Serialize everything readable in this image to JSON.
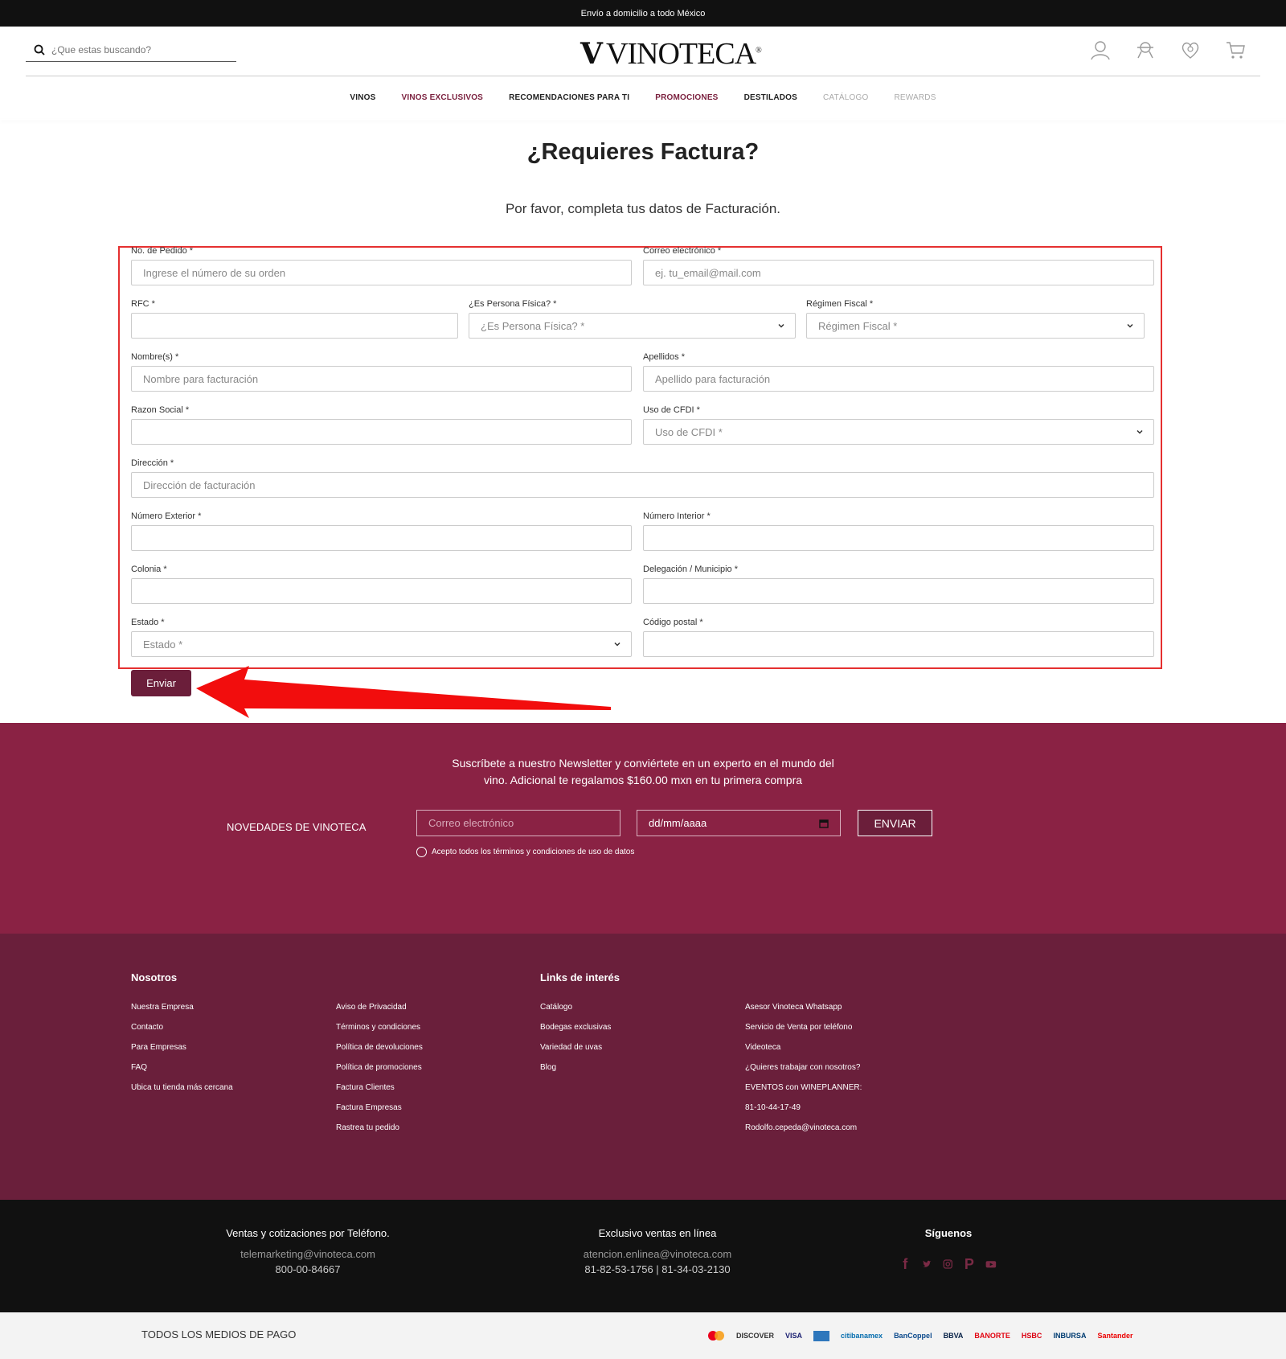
{
  "topbar": {
    "text": "Envío a domicilio a todo México"
  },
  "header": {
    "search_placeholder": "¿Que estas buscando?",
    "logo_text": "VINOTECA",
    "logo_reg": "®"
  },
  "nav": {
    "items": [
      {
        "label": "VINOS",
        "style": "dark"
      },
      {
        "label": "VINOS EXCLUSIVOS",
        "style": "red"
      },
      {
        "label": "RECOMENDACIONES PARA TI",
        "style": "dark"
      },
      {
        "label": "PROMOCIONES",
        "style": "red"
      },
      {
        "label": "DESTILADOS",
        "style": "dark"
      },
      {
        "label": "CATÁLOGO",
        "style": "gray"
      },
      {
        "label": "REWARDS",
        "style": "gray"
      }
    ]
  },
  "page": {
    "title": "¿Requieres Factura?",
    "subtitle": "Por favor, completa tus datos de Facturación."
  },
  "form": {
    "pedido": {
      "label": "No. de Pedido *",
      "placeholder": "Ingrese el número de su orden"
    },
    "correo": {
      "label": "Correo electrónico *",
      "placeholder": "ej. tu_email@mail.com"
    },
    "rfc": {
      "label": "RFC *",
      "placeholder": ""
    },
    "persona": {
      "label": "¿Es Persona Física? *",
      "placeholder": "¿Es Persona Física? *"
    },
    "regimen": {
      "label": "Régimen Fiscal *",
      "placeholder": "Régimen Fiscal *"
    },
    "nombre": {
      "label": "Nombre(s) *",
      "placeholder": "Nombre para facturación"
    },
    "apellidos": {
      "label": "Apellidos *",
      "placeholder": "Apellido para facturación"
    },
    "razon": {
      "label": "Razon Social *",
      "placeholder": ""
    },
    "cfdi": {
      "label": "Uso de CFDI *",
      "placeholder": "Uso de CFDI *"
    },
    "direccion": {
      "label": "Dirección *",
      "placeholder": "Dirección de facturación"
    },
    "num_ext": {
      "label": "Número Exterior *",
      "placeholder": ""
    },
    "num_int": {
      "label": "Número Interior *",
      "placeholder": ""
    },
    "colonia": {
      "label": "Colonia *",
      "placeholder": ""
    },
    "delegacion": {
      "label": "Delegación / Municipio *",
      "placeholder": ""
    },
    "estado": {
      "label": "Estado *",
      "placeholder": "Estado *"
    },
    "cp": {
      "label": "Código postal *",
      "placeholder": ""
    },
    "submit": "Enviar"
  },
  "newsletter": {
    "text": "Suscríbete a nuestro Newsletter y conviértete en un experto en el mundo del vino. Adicional te regalamos $160.00 mxn en tu primera compra",
    "label": "NOVEDADES DE VINOTECA",
    "email_placeholder": "Correo electrónico",
    "date_placeholder": "dd/mm/aaaa",
    "send": "ENVIAR",
    "terms": "Acepto todos los términos y condiciones de uso de datos"
  },
  "footer": {
    "nosotros_title": "Nosotros",
    "links_title": "Links de interés",
    "col1": [
      "Nuestra Empresa",
      "Contacto",
      "Para Empresas",
      "FAQ",
      "Ubica tu tienda más cercana"
    ],
    "col2": [
      "Aviso de Privacidad",
      "Términos y condiciones",
      "Política de devoluciones",
      "Política de promociones",
      "Factura Clientes",
      "Factura Empresas",
      "Rastrea tu pedido"
    ],
    "col3": [
      "Catálogo",
      "Bodegas exclusivas",
      "Variedad de uvas",
      "Blog"
    ],
    "col4": [
      "Asesor Vinoteca Whatsapp",
      "Servicio de Venta por teléfono",
      "Videoteca",
      "¿Quieres trabajar con nosotros?",
      "EVENTOS con WINEPLANNER:",
      "81-10-44-17-49",
      "Rodolfo.cepeda@vinoteca.com"
    ]
  },
  "contact": {
    "phone_title": "Ventas y cotizaciones por Teléfono.",
    "phone_email": "telemarketing@vinoteca.com",
    "phone_number": "800-00-84667",
    "online_title": "Exclusivo ventas en línea",
    "online_email": "atencion.enlinea@vinoteca.com",
    "online_numbers": "81-82-53-1756 | 81-34-03-2130",
    "social_title": "Síguenos"
  },
  "payments": {
    "label": "TODOS LOS MEDIOS DE PAGO",
    "logos": [
      "DISCOVER",
      "VISA",
      "citibanamex",
      "BanCoppel",
      "BBVA",
      "BANORTE",
      "HSBC",
      "INBURSA",
      "Santander"
    ]
  },
  "colors": {
    "brand": "#8a2244",
    "brand_dark": "#6a1f3b",
    "highlight": "#e53030"
  }
}
